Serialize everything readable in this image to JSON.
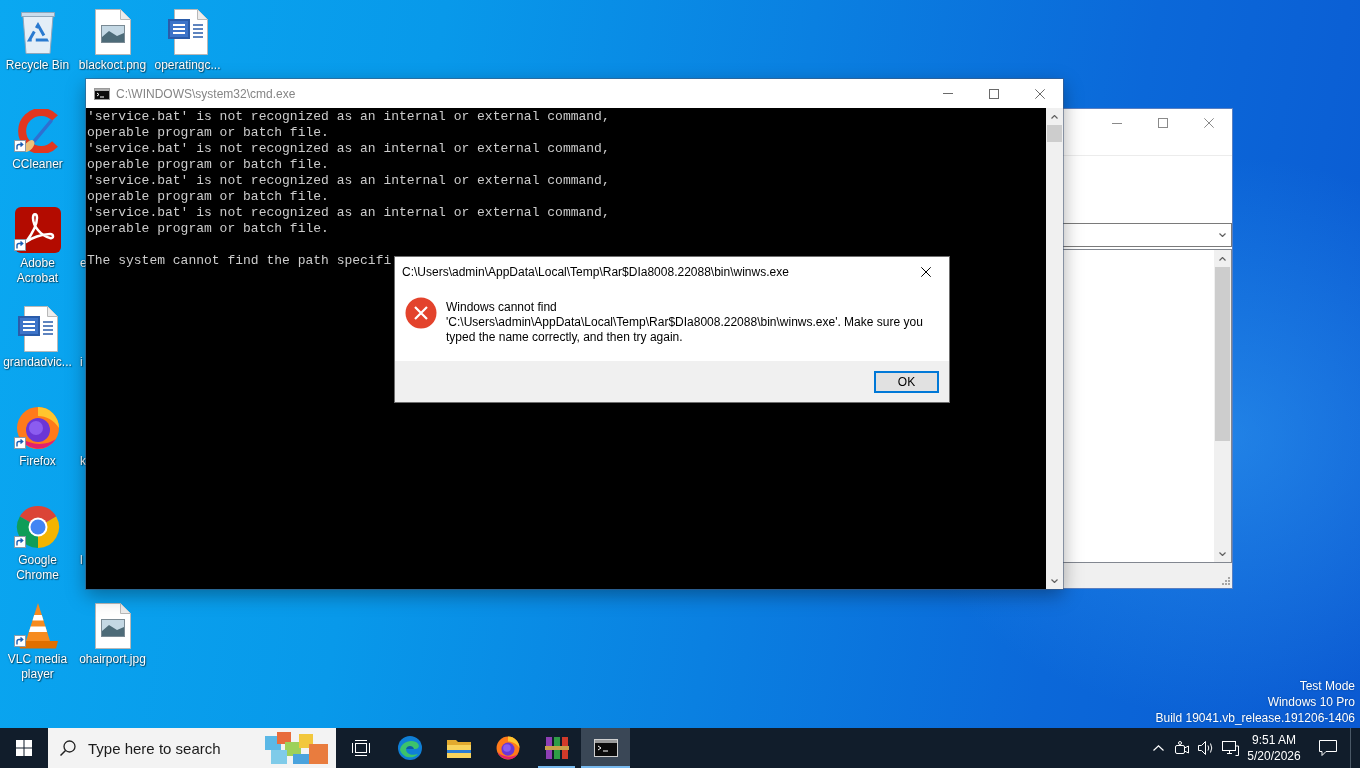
{
  "desktop": {
    "rows": [
      [
        {
          "label": "Recycle Bin",
          "kind": "recycle",
          "shortcut": false
        },
        {
          "label": "blackoct.png",
          "kind": "image",
          "shortcut": false
        },
        {
          "label": "operatingc...",
          "kind": "word",
          "shortcut": false
        }
      ],
      [
        {
          "label": "CCleaner",
          "kind": "ccleaner",
          "shortcut": true
        }
      ],
      [
        {
          "label": "Adobe Acrobat",
          "kind": "acrobat",
          "shortcut": true
        },
        {
          "label": "e",
          "kind": "covered",
          "shortcut": false
        }
      ],
      [
        {
          "label": "grandadvic...",
          "kind": "word",
          "shortcut": false
        },
        {
          "label": "i",
          "kind": "covered",
          "shortcut": false
        }
      ],
      [
        {
          "label": "Firefox",
          "kind": "firefox",
          "shortcut": true
        },
        {
          "label": "k",
          "kind": "covered",
          "shortcut": false
        }
      ],
      [
        {
          "label": "Google Chrome",
          "kind": "chrome",
          "shortcut": true
        },
        {
          "label": "l",
          "kind": "covered",
          "shortcut": false
        }
      ],
      [
        {
          "label": "VLC media player",
          "kind": "vlc",
          "shortcut": true
        },
        {
          "label": "ohairport.jpg",
          "kind": "image",
          "shortcut": false
        }
      ]
    ]
  },
  "console_window": {
    "title": "C:\\WINDOWS\\system32\\cmd.exe",
    "active": false,
    "output_blocks": [
      [
        "'service.bat' is not recognized as an internal or external command,",
        "operable program or batch file.",
        "'service.bat' is not recognized as an internal or external command,",
        "operable program or batch file.",
        "'service.bat' is not recognized as an internal or external command,",
        "operable program or batch file.",
        "'service.bat' is not recognized as an internal or external command,",
        "operable program or batch file."
      ],
      [
        "The system cannot find the path specifi"
      ]
    ]
  },
  "error_dialog": {
    "title": "C:\\Users\\admin\\AppData\\Local\\Temp\\Rar$DIa8008.22088\\bin\\winws.exe",
    "message": "Windows cannot find 'C:\\Users\\admin\\AppData\\Local\\Temp\\Rar$DIa8008.22088\\bin\\winws.exe'. Make sure you typed the name correctly, and then try again.",
    "buttons": [
      {
        "label": "OK",
        "default": true
      }
    ]
  },
  "system_notice": [
    "Test Mode",
    "Windows 10 Pro",
    "Build 19041.vb_release.191206-1406"
  ],
  "taskbar": {
    "search": {
      "placeholder": "Type here to search"
    },
    "apps": [
      {
        "kind": "taskview",
        "running": false,
        "selected": false
      },
      {
        "kind": "edge",
        "running": false,
        "selected": false
      },
      {
        "kind": "explorer",
        "running": false,
        "selected": false
      },
      {
        "kind": "firefox",
        "running": false,
        "selected": false
      },
      {
        "kind": "winrar",
        "running": true,
        "selected": false
      },
      {
        "kind": "cmd",
        "running": true,
        "selected": true
      }
    ],
    "clock": {
      "time": "9:51 AM",
      "date": "5/20/2026"
    }
  }
}
